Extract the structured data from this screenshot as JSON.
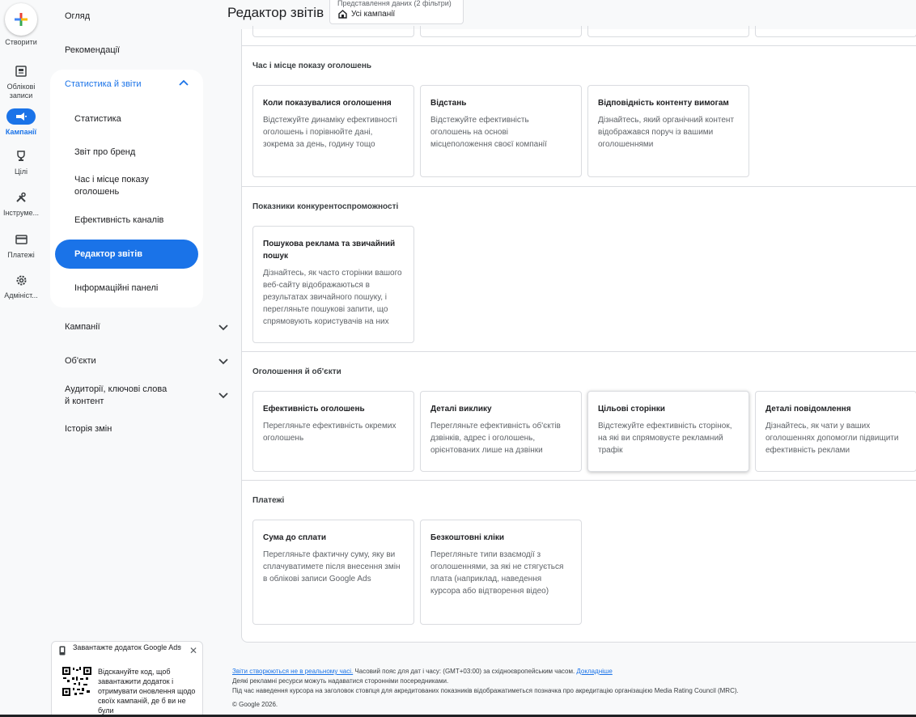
{
  "rail": {
    "create_label": "Створити",
    "items": [
      {
        "label": "Облікові записи",
        "icon": "accounts-icon"
      },
      {
        "label": "Кампанії",
        "icon": "campaigns-icon"
      },
      {
        "label": "Цілі",
        "icon": "goals-icon"
      },
      {
        "label": "Інструме...",
        "icon": "tools-icon"
      },
      {
        "label": "Платежі",
        "icon": "billing-icon"
      },
      {
        "label": "Адмініст...",
        "icon": "admin-icon"
      }
    ]
  },
  "sidenav": {
    "overview": "Огляд",
    "recommendations": "Рекомендації",
    "group_title": "Статистика й звіти",
    "sub_items": [
      "Статистика",
      "Звіт про бренд",
      "Час і місце показу оголошень",
      "Ефективність каналів",
      "Редактор звітів",
      "Інформаційні панелі"
    ],
    "campaigns": "Кампанії",
    "assets": "Об'єкти",
    "audiences": "Аудиторії, ключові слова й контент",
    "history": "Історія змін"
  },
  "promo": {
    "title": "Завантажте додаток Google Ads",
    "text": "Відскануйте код, щоб завантажити додаток і отримувати оновлення щодо своїх кампаній, де б ви не були"
  },
  "header": {
    "title": "Редактор звітів",
    "view_label": "Представлення даних (2 фільтри)",
    "view_value": "Усі кампанії"
  },
  "sections": [
    {
      "title": "Час і місце показу оголошень",
      "cards": [
        {
          "title": "Коли показувалися оголошення",
          "desc": "Відстежуйте динаміку ефективності оголошень і порівнюйте дані, зокрема за день, годину тощо"
        },
        {
          "title": "Відстань",
          "desc": "Відстежуйте ефективність оголошень на основі місцеположення своєї компанії"
        },
        {
          "title": "Відповідність контенту вимогам",
          "desc": "Дізнайтесь, який органічний контент відображався поруч із вашими оголошеннями"
        }
      ]
    },
    {
      "title": "Показники конкурентоспроможності",
      "cards": [
        {
          "title": "Пошукова реклама та звичайний пошук",
          "desc": "Дізнайтесь, як часто сторінки вашого веб-сайту відображаються в результатах звичайного пошуку, і перегляньте пошукові запити, що спрямовують користувачів на них"
        }
      ]
    },
    {
      "title": "Оголошення й об'єкти",
      "cards": [
        {
          "title": "Ефективність оголошень",
          "desc": "Перегляньте ефективність окремих оголошень"
        },
        {
          "title": "Деталі виклику",
          "desc": "Перегляньте ефективність об'єктів дзвінків, адрес і оголошень, орієнтованих лише на дзвінки"
        },
        {
          "title": "Цільові сторінки",
          "desc": "Відстежуйте ефективність сторінок, на які ви спрямовуєте рекламний трафік"
        },
        {
          "title": "Деталі повідомлення",
          "desc": "Дізнайтесь, як чати у ваших оголошеннях допомогли підвищити ефективність реклами"
        }
      ]
    },
    {
      "title": "Платежі",
      "cards": [
        {
          "title": "Сума до сплати",
          "desc": "Перегляньте фактичну суму, яку ви сплачуватимете після внесення змін в облікові записи Google Ads"
        },
        {
          "title": "Безкоштовні кліки",
          "desc": "Перегляньте типи взаємодії з оголошеннями, за які не стягується плата (наприклад, наведення курсора або відтворення відео)"
        }
      ]
    }
  ],
  "footer": {
    "not_realtime_link": "Звіти створюються не в реальному часі.",
    "timezone": " Часовий пояс для дат і часу: (GMT+03:00) за східноєвропейським часом. ",
    "details_link": "Докладніше",
    "line2": "Деякі рекламні ресурси можуть надаватися сторонніми посередниками.",
    "line3": "Під час наведення курсора на заголовок стовпця для акредитованих показників відображатиметься позначка про акредитацію організацією Media Rating Council (MRC).",
    "copyright": "© Google 2026."
  }
}
